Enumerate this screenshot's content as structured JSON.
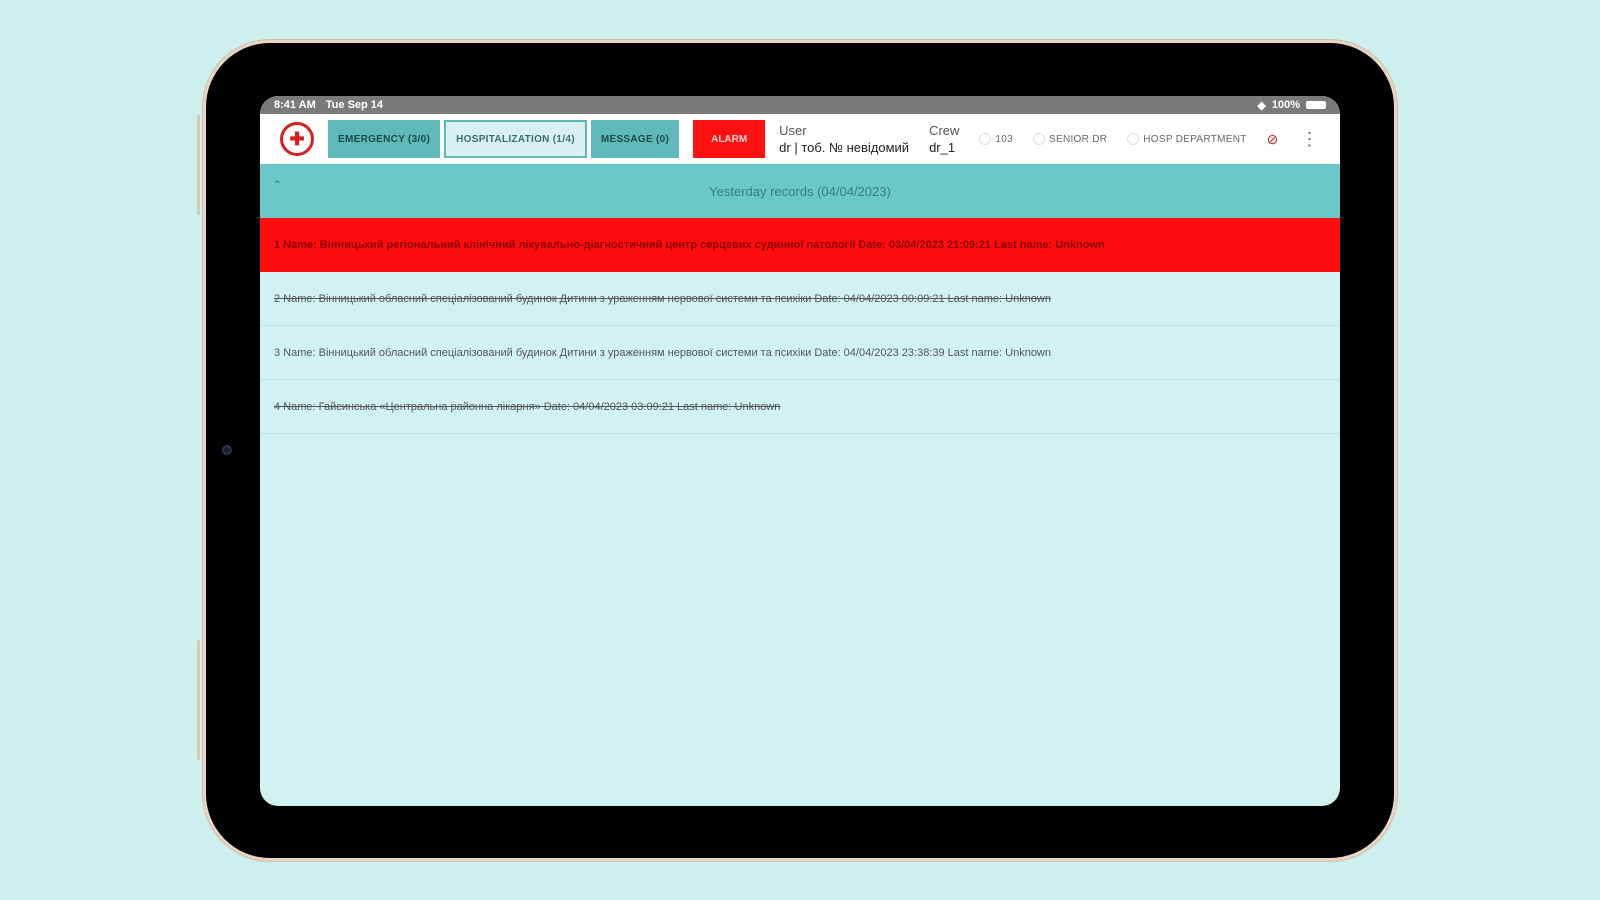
{
  "status": {
    "time": "8:41 AM",
    "date": "Tue Sep 14",
    "battery": "100%"
  },
  "toolbar": {
    "tabs": [
      {
        "label": "EMERGENCY (3/0)"
      },
      {
        "label": "HOSPITALIZATION (1/4)"
      },
      {
        "label": "MESSAGE (0)"
      }
    ],
    "alarm_label": "ALARM",
    "user_label": "User",
    "user_value": "dr | тоб. № невідомий",
    "crew_label": "Crew",
    "crew_value": "dr_1",
    "pills": [
      {
        "label": "103"
      },
      {
        "label": "SENIOR DR"
      },
      {
        "label": "HOSP DEPARTMENT"
      }
    ]
  },
  "section": {
    "title": "Yesterday records (04/04/2023)"
  },
  "records": [
    {
      "text": "1 Name: Вінницький регіональний клінічний лікувально-діагностичний центр серцевих судинної патології Date: 03/04/2023 21:09:21 Last name: Unknown"
    },
    {
      "text": "2 Name: Вінницький обласний спеціалізований будинок Дитини з ураженням нервової системи та психіки Date: 04/04/2023 00:09:21 Last name: Unknown"
    },
    {
      "text": "3 Name: Вінницький обласний спеціалізований будинок Дитини з ураженням нервової системи та психіки Date: 04/04/2023 23:38:39 Last name: Unknown"
    },
    {
      "text": "4 Name: Гайсинська «Центральна районна лікарня» Date: 04/04/2023 03:09:21 Last name: Unknown"
    }
  ]
}
